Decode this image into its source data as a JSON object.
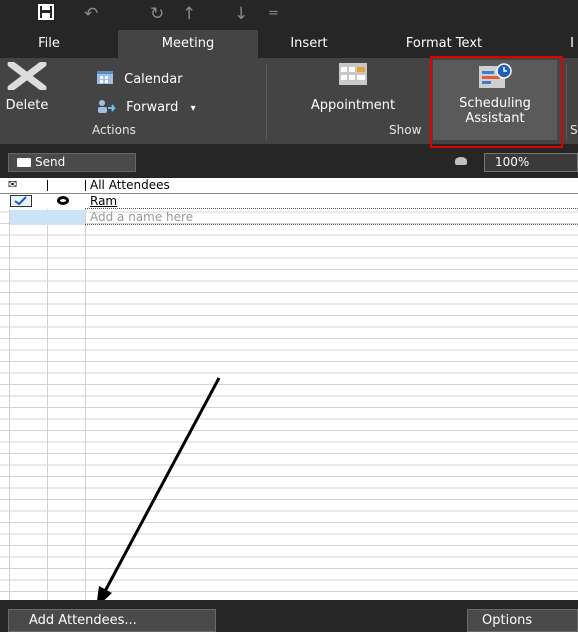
{
  "qat": {
    "icons": [
      "save-icon",
      "undo-icon",
      "redo-icon",
      "up-icon",
      "down-icon",
      "customize-icon"
    ]
  },
  "tabs": [
    {
      "label": "File"
    },
    {
      "label": "Meeting",
      "active": true
    },
    {
      "label": "Insert"
    },
    {
      "label": "Format Text"
    },
    {
      "label": "I"
    }
  ],
  "ribbon": {
    "delete_label": "Delete",
    "calendar_label": "Calendar",
    "forward_label": "Forward",
    "forward_caret": "▾",
    "actions_group": "Actions",
    "appointment_label": "Appointment",
    "scheduling_label_1": "Scheduling",
    "scheduling_label_2": "Assistant",
    "show_group": "Show",
    "next_group_partial": "S"
  },
  "toolbar": {
    "send_label": "Send",
    "zoom_value": "100%"
  },
  "attendees": {
    "header": "All Attendees",
    "rows": [
      {
        "name": "Ram",
        "checked": true
      }
    ],
    "add_placeholder": "Add a name here"
  },
  "bottom": {
    "add_attendees_label": "Add Attendees...",
    "options_label": "Options"
  },
  "colors": {
    "ribbon_bg": "#444444",
    "titlebar_bg": "#262626",
    "highlight": "#e00000",
    "selected_row": "#cde3f7"
  }
}
